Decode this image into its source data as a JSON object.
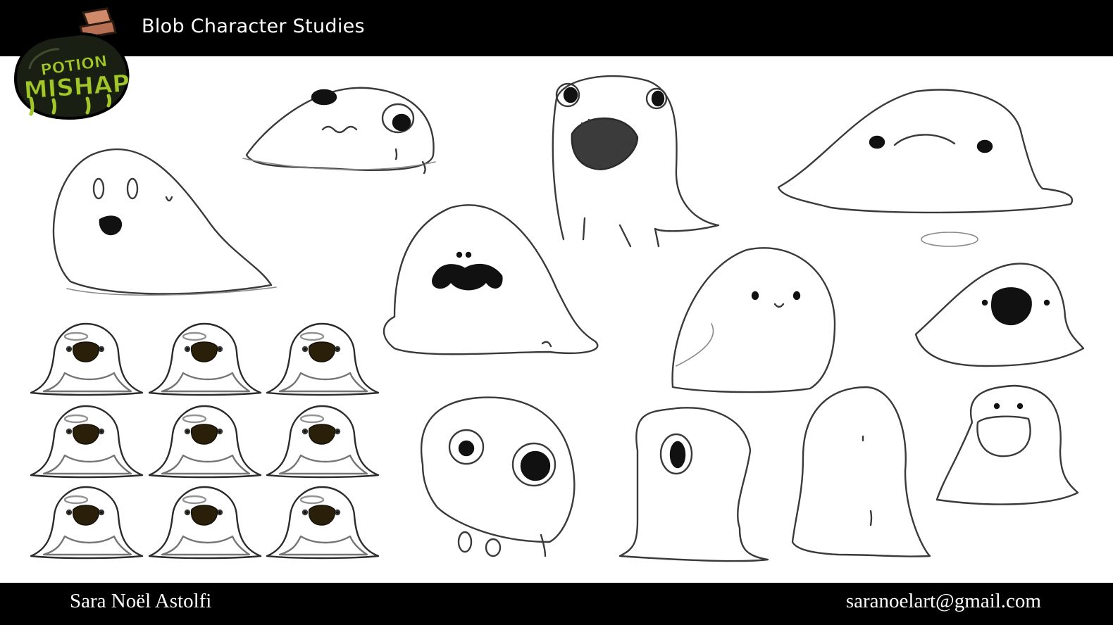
{
  "header": {
    "title": "Blob Character Studies",
    "logo": {
      "line1": "POTION",
      "line2": "MISHAP"
    }
  },
  "footer": {
    "author": "Sara Noël Astolfi",
    "email": "saranoelart@gmail.com"
  },
  "colors": {
    "bar": "#000000",
    "background": "#ffffff",
    "logo_slime": "#a3c72a",
    "logo_glass": "#1a1f14",
    "cork": "#d08a6a"
  },
  "color_variants": [
    {
      "fill": "#a7b531",
      "shade": "#8a9a22"
    },
    {
      "fill": "#c7c23a",
      "shade": "#a9a42a"
    },
    {
      "fill": "#c3b836",
      "shade": "#a59b25"
    },
    {
      "fill": "#dcd43e",
      "shade": "#bdb52b"
    },
    {
      "fill": "#c6c536",
      "shade": "#a6a726"
    },
    {
      "fill": "#ccc538",
      "shade": "#aea727"
    },
    {
      "fill": "#c4d23a",
      "shade": "#a4b42a"
    },
    {
      "fill": "#ee8a1c",
      "shade": "#d06d12"
    },
    {
      "fill": "#6cd33d",
      "shade": "#4fb42a"
    }
  ]
}
